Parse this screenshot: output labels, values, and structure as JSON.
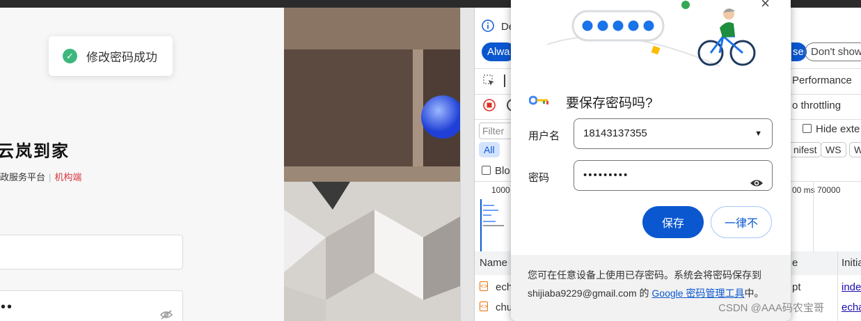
{
  "toast": {
    "text": "修改密码成功"
  },
  "login": {
    "brand": "云岚到家",
    "subtitle_main": "政服务平台",
    "subtitle_divider": "|",
    "subtitle_role": "机构端",
    "password_mask": "••"
  },
  "devtools": {
    "info_text": "De",
    "always_btn": "Alwa",
    "close_btn": "se",
    "dont_show_btn": "Don't show",
    "performance_tab": "Performance",
    "throttling": "o throttling",
    "filter_placeholder": "Filter",
    "hide_ext": "Hide exte",
    "filter_all": "All",
    "filter_manifest": "nifest",
    "filter_ws": "WS",
    "filter_w": "W",
    "block_label": "Blo",
    "timeline": [
      "1000",
      "00 ms",
      "70000"
    ],
    "col_name": "Name",
    "col_type": "e",
    "col_initiator": "Initia",
    "rows": [
      {
        "name": "ech",
        "type": "pt",
        "initiator": "inde"
      },
      {
        "name": "chu",
        "type": "",
        "initiator": "echa"
      }
    ]
  },
  "popup": {
    "title": "要保存密码吗?",
    "username_label": "用户名",
    "username_value": "18143137355",
    "password_label": "密码",
    "password_value": "•••••••••",
    "save_btn": "保存",
    "never_btn": "一律不",
    "footer_part1": "您可在任意设备上使用已存密码。系统会将密码保存到 shijiaba9229@gmail.com 的 ",
    "footer_link": "Google 密码管理工具",
    "footer_part2": "中。"
  },
  "watermark": "CSDN @AAA码农宝哥",
  "colors": {
    "accent": "#0b57d0",
    "success": "#3db77e",
    "role_red": "#d9363e"
  }
}
